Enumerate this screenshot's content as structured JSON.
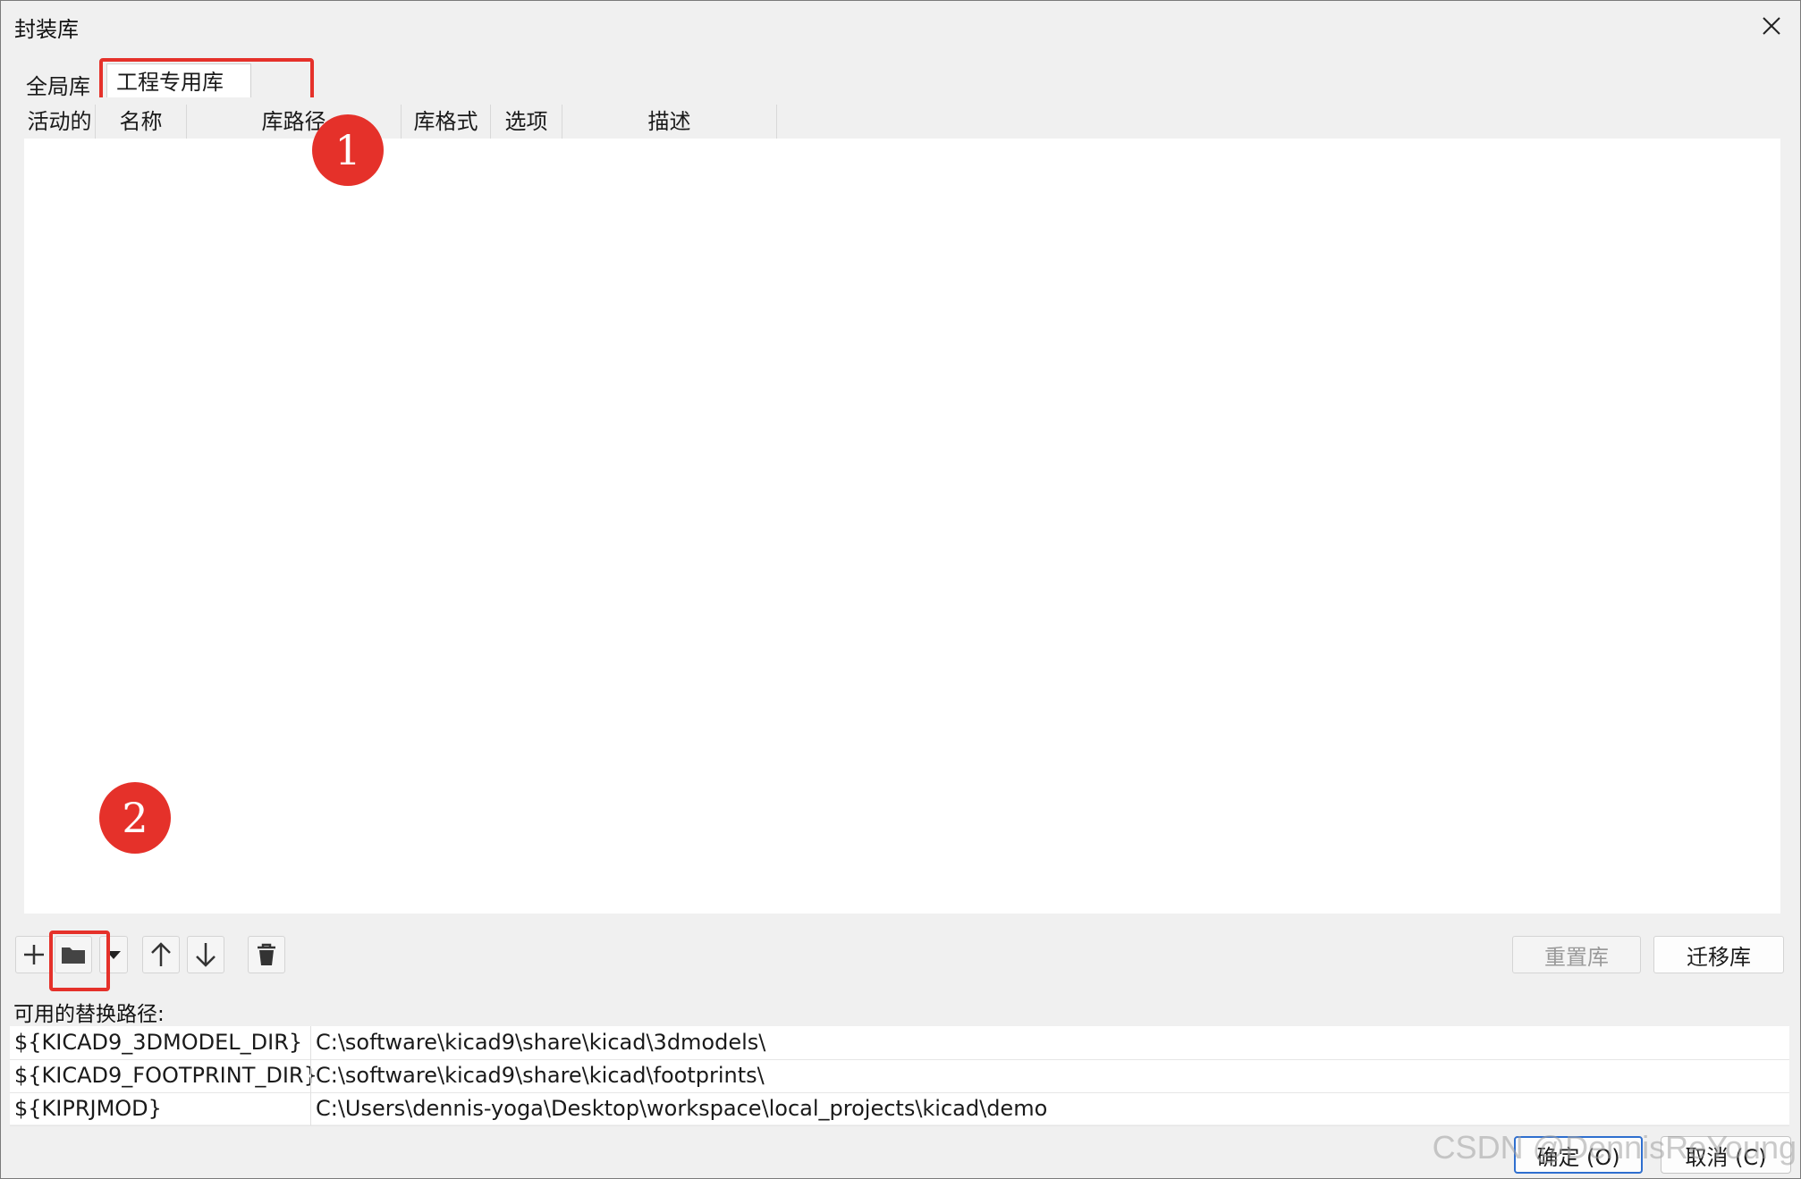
{
  "window": {
    "title": "封装库"
  },
  "tabs": [
    {
      "label": "全局库"
    },
    {
      "label": "工程专用库"
    }
  ],
  "grid": {
    "columns": [
      "活动的",
      "名称",
      "库路径",
      "库格式",
      "选项",
      "描述"
    ]
  },
  "annotations": {
    "marker1": "1",
    "marker2": "2",
    "accent_color": "#e5312a"
  },
  "toolbar": {
    "icons": [
      "plus-icon",
      "folder-icon",
      "dropdown-arrow-icon",
      "arrow-up-icon",
      "arrow-down-icon",
      "trash-icon"
    ],
    "reset_label": "重置库",
    "migrate_label": "迁移库"
  },
  "substitutions": {
    "label": "可用的替换路径:",
    "rows": [
      {
        "name": "${KICAD9_3DMODEL_DIR}",
        "path": "C:\\software\\kicad9\\share\\kicad\\3dmodels\\"
      },
      {
        "name": "${KICAD9_FOOTPRINT_DIR}",
        "path": "C:\\software\\kicad9\\share\\kicad\\footprints\\"
      },
      {
        "name": "${KIPRJMOD}",
        "path": "C:\\Users\\dennis-yoga\\Desktop\\workspace\\local_projects\\kicad\\demo"
      }
    ]
  },
  "dialog_buttons": {
    "ok": "确定 (O)",
    "cancel": "取消 (C)"
  },
  "watermark": "CSDN @DennisReYoung"
}
